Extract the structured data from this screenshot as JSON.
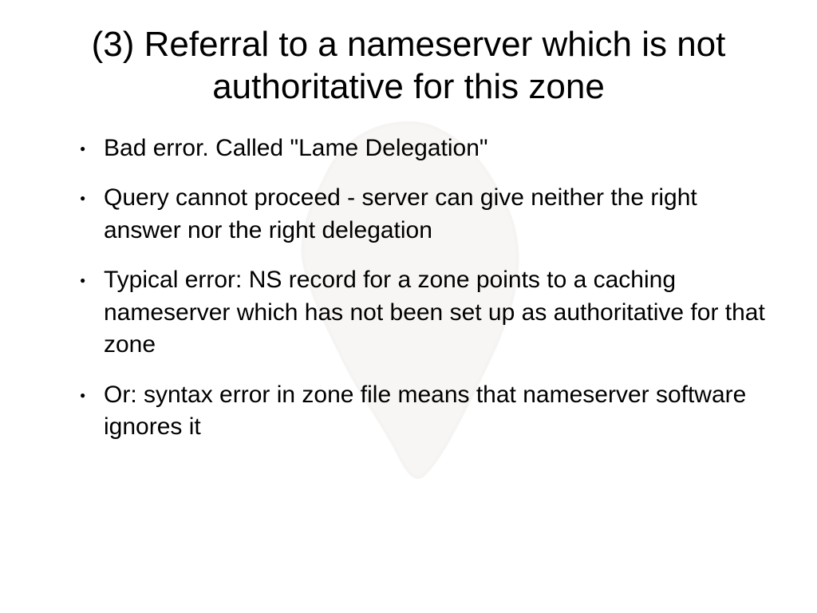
{
  "slide": {
    "title": "(3) Referral to a nameserver which is not authoritative for this zone",
    "bullets": [
      "Bad error. Called \"Lame Delegation\"",
      "Query cannot proceed - server can give neither the right answer nor the right delegation",
      "Typical error: NS record for a zone points to a caching nameserver which has not been set up as authoritative for that zone",
      "Or: syntax error in zone file means that nameserver software ignores it"
    ]
  }
}
